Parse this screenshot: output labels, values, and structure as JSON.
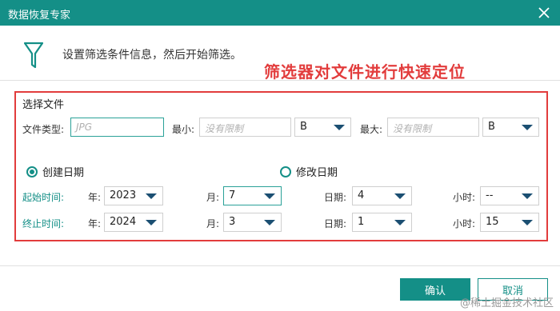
{
  "window": {
    "title": "数据恢复专家"
  },
  "header": {
    "info": "设置筛选条件信息，然后开始筛选。",
    "hint": "筛选器对文件进行快速定位"
  },
  "filter": {
    "section_title": "选择文件",
    "file_type_label": "文件类型:",
    "file_type_placeholder": "JPG",
    "min_label": "最小:",
    "min_placeholder": "没有限制",
    "min_unit": "B",
    "max_label": "最大:",
    "max_placeholder": "没有限制",
    "max_unit": "B"
  },
  "date_mode": {
    "created_label": "创建日期",
    "modified_label": "修改日期",
    "selected": "created"
  },
  "start": {
    "label": "起始时间:",
    "year_label": "年:",
    "year": "2023",
    "month_label": "月:",
    "month": "7",
    "day_label": "日期:",
    "day": "4",
    "hour_label": "小时:",
    "hour": "--"
  },
  "end": {
    "label": "终止时间:",
    "year_label": "年:",
    "year": "2024",
    "month_label": "月:",
    "month": "3",
    "day_label": "日期:",
    "day": "1",
    "hour_label": "小时:",
    "hour": "15"
  },
  "buttons": {
    "ok": "确认",
    "cancel": "取消"
  },
  "watermark": "@稀土掘金技术社区",
  "colors": {
    "accent": "#148f87",
    "highlight": "#e23c3c"
  }
}
